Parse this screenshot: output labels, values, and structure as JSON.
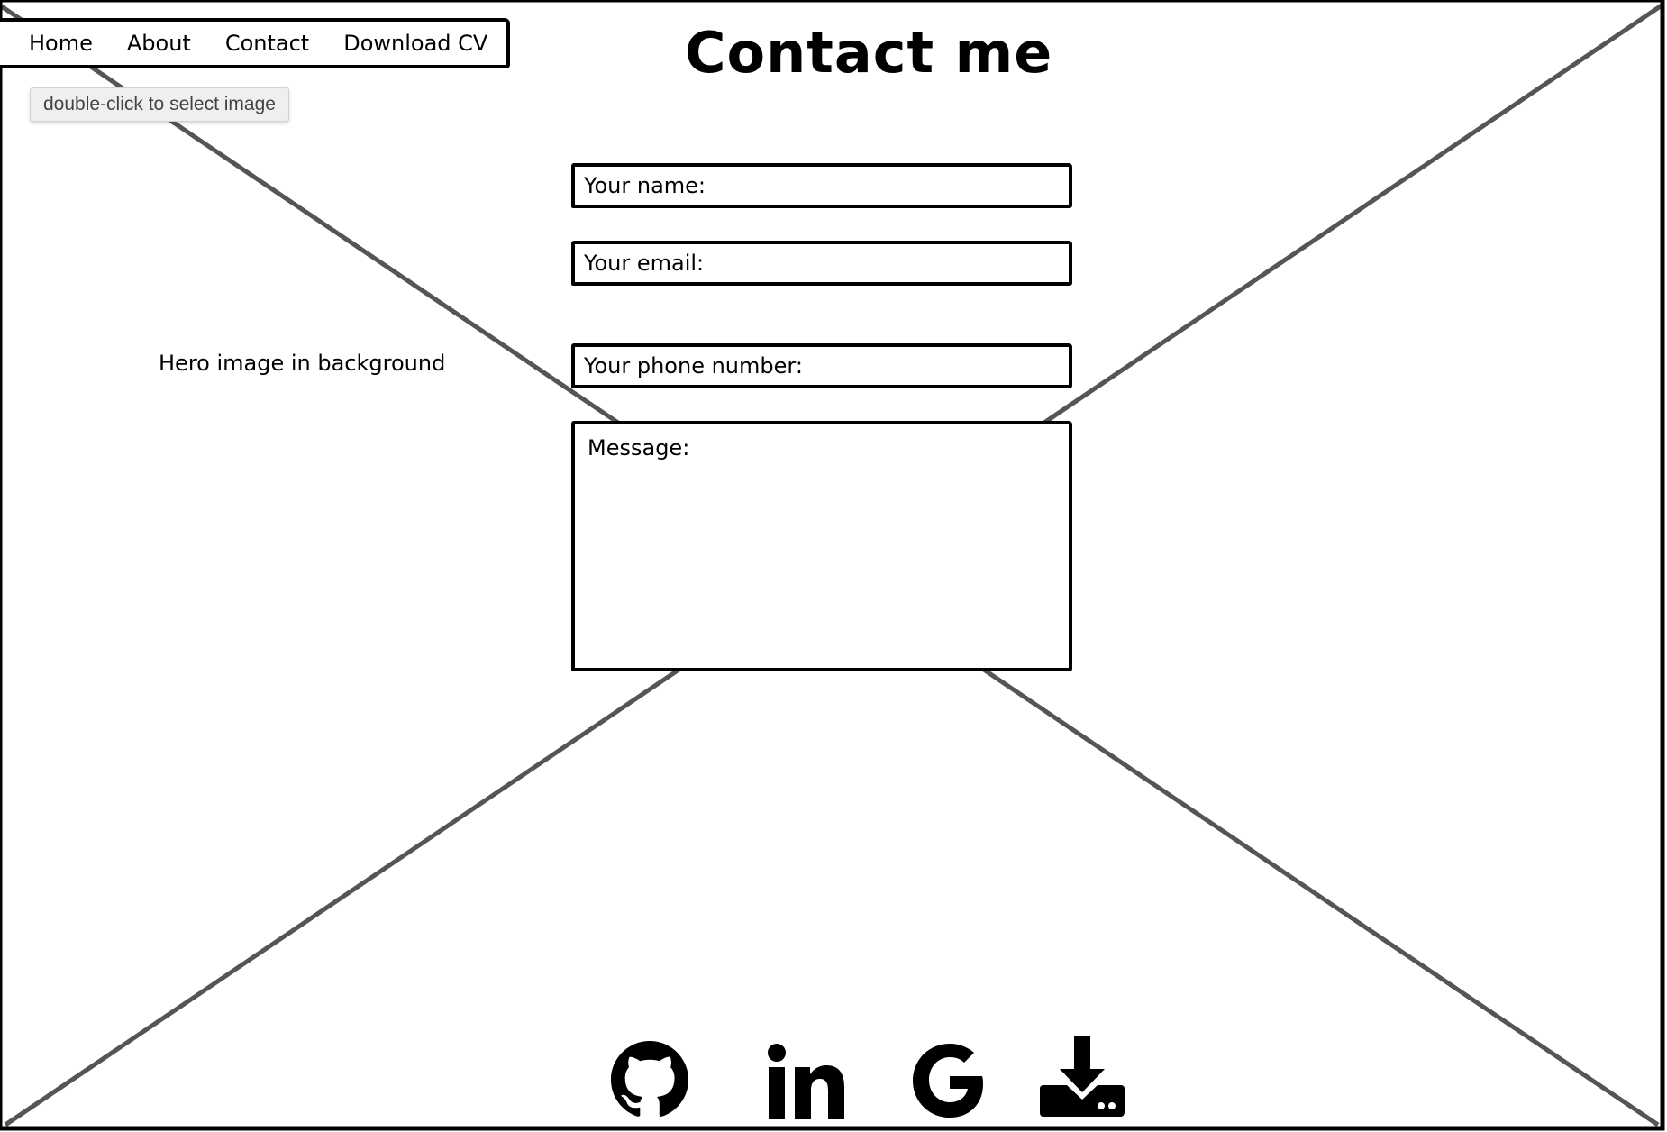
{
  "nav": {
    "items": [
      {
        "label": "Home"
      },
      {
        "label": "About"
      },
      {
        "label": "Contact"
      },
      {
        "label": "Download CV"
      }
    ]
  },
  "tooltip": "double-click to select image",
  "page_title": "Contact me",
  "hero_label": "Hero image in background",
  "form": {
    "name_label": "Your name:",
    "email_label": "Your email:",
    "phone_label": "Your phone number:",
    "message_label": "Message:"
  },
  "socials": [
    {
      "icon": "github-icon"
    },
    {
      "icon": "linkedin-icon"
    },
    {
      "icon": "google-icon"
    },
    {
      "icon": "download-icon"
    }
  ],
  "colors": {
    "outline": "#000000",
    "placeholder_cross": "#555555",
    "tooltip_bg": "#efefef",
    "tooltip_text": "#444444"
  }
}
